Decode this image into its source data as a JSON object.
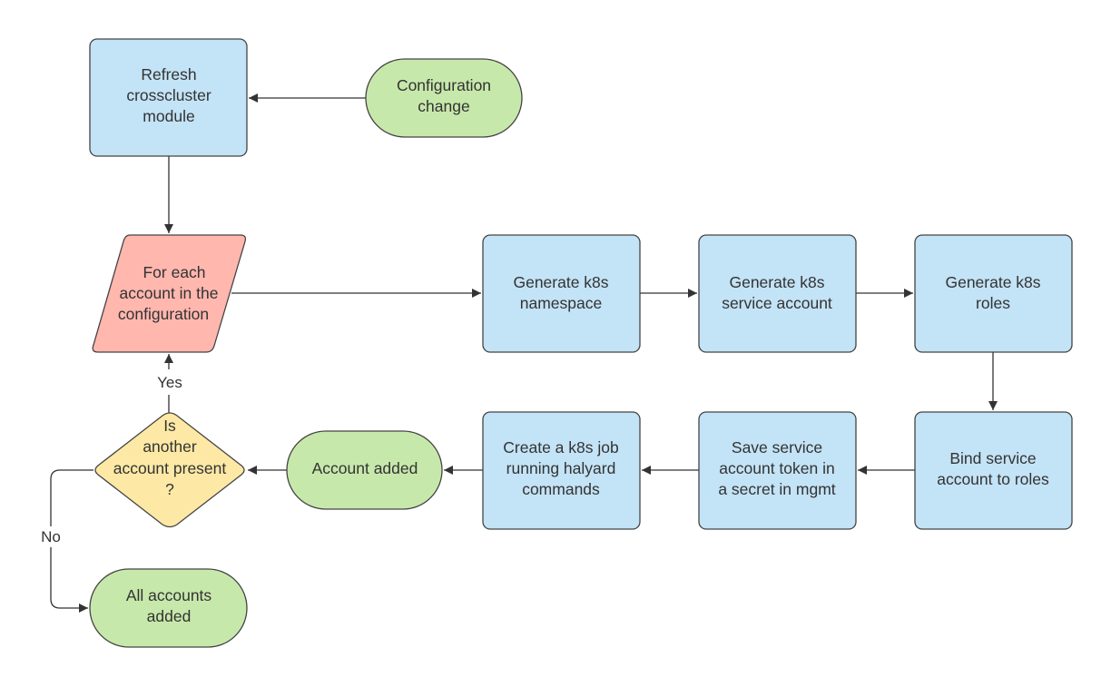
{
  "colors": {
    "process": "#c3e3f6",
    "terminal": "#c7e8ab",
    "loop": "#ffb7ae",
    "decision": "#fde9a5",
    "stroke": "#444444"
  },
  "nodes": {
    "refresh": {
      "lines": [
        "Refresh",
        "crosscluster",
        "module"
      ]
    },
    "config_change": {
      "lines": [
        "Configuration",
        "change"
      ]
    },
    "for_each": {
      "lines": [
        "For each",
        "account in the",
        "configuration"
      ]
    },
    "gen_namespace": {
      "lines": [
        "Generate k8s",
        "namespace"
      ]
    },
    "gen_service_account": {
      "lines": [
        "Generate k8s",
        "service account"
      ]
    },
    "gen_roles": {
      "lines": [
        "Generate k8s",
        "roles"
      ]
    },
    "bind": {
      "lines": [
        "Bind service",
        "account to roles"
      ]
    },
    "save_token": {
      "lines": [
        "Save service",
        "account token in",
        "a secret in mgmt"
      ]
    },
    "create_job": {
      "lines": [
        "Create a k8s job",
        "running halyard",
        "commands"
      ]
    },
    "account_added": {
      "lines": [
        "Account added"
      ]
    },
    "decision": {
      "lines": [
        "Is",
        "another",
        "account present",
        "?"
      ]
    },
    "all_added": {
      "lines": [
        "All accounts",
        "added"
      ]
    }
  },
  "edges": {
    "yes_label": "Yes",
    "no_label": "No"
  }
}
